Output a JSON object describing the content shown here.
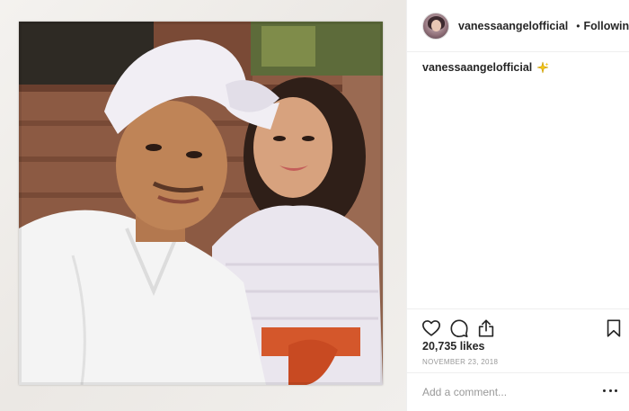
{
  "header": {
    "username": "vanessaangelofficial",
    "dot": "•",
    "follow_status": "Following"
  },
  "caption": {
    "username": "vanessaangelofficial"
  },
  "stats": {
    "likes": "20,735 likes",
    "date": "NOVEMBER 23, 2018"
  },
  "comment": {
    "placeholder": "Add a comment..."
  },
  "icons": {
    "verified": "verified-badge-icon",
    "heart": "heart-icon",
    "comment": "comment-icon",
    "share": "share-icon",
    "bookmark": "bookmark-icon",
    "more": "more-options-icon",
    "sparkle": "sparkle-emoji-icon"
  },
  "colors": {
    "verified_blue": "#3897f0",
    "text": "#262626",
    "muted": "#999999",
    "sash": "#d4572b"
  }
}
